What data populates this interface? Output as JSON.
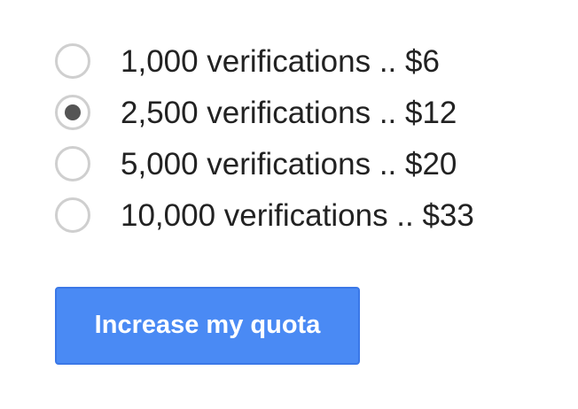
{
  "quota_options": [
    {
      "label": "1,000 verifications .. $6",
      "selected": false
    },
    {
      "label": "2,500 verifications .. $12",
      "selected": true
    },
    {
      "label": "5,000 verifications .. $20",
      "selected": false
    },
    {
      "label": "10,000 verifications .. $33",
      "selected": false
    }
  ],
  "submit": {
    "label": "Increase my quota",
    "color": "#4a8af4"
  }
}
